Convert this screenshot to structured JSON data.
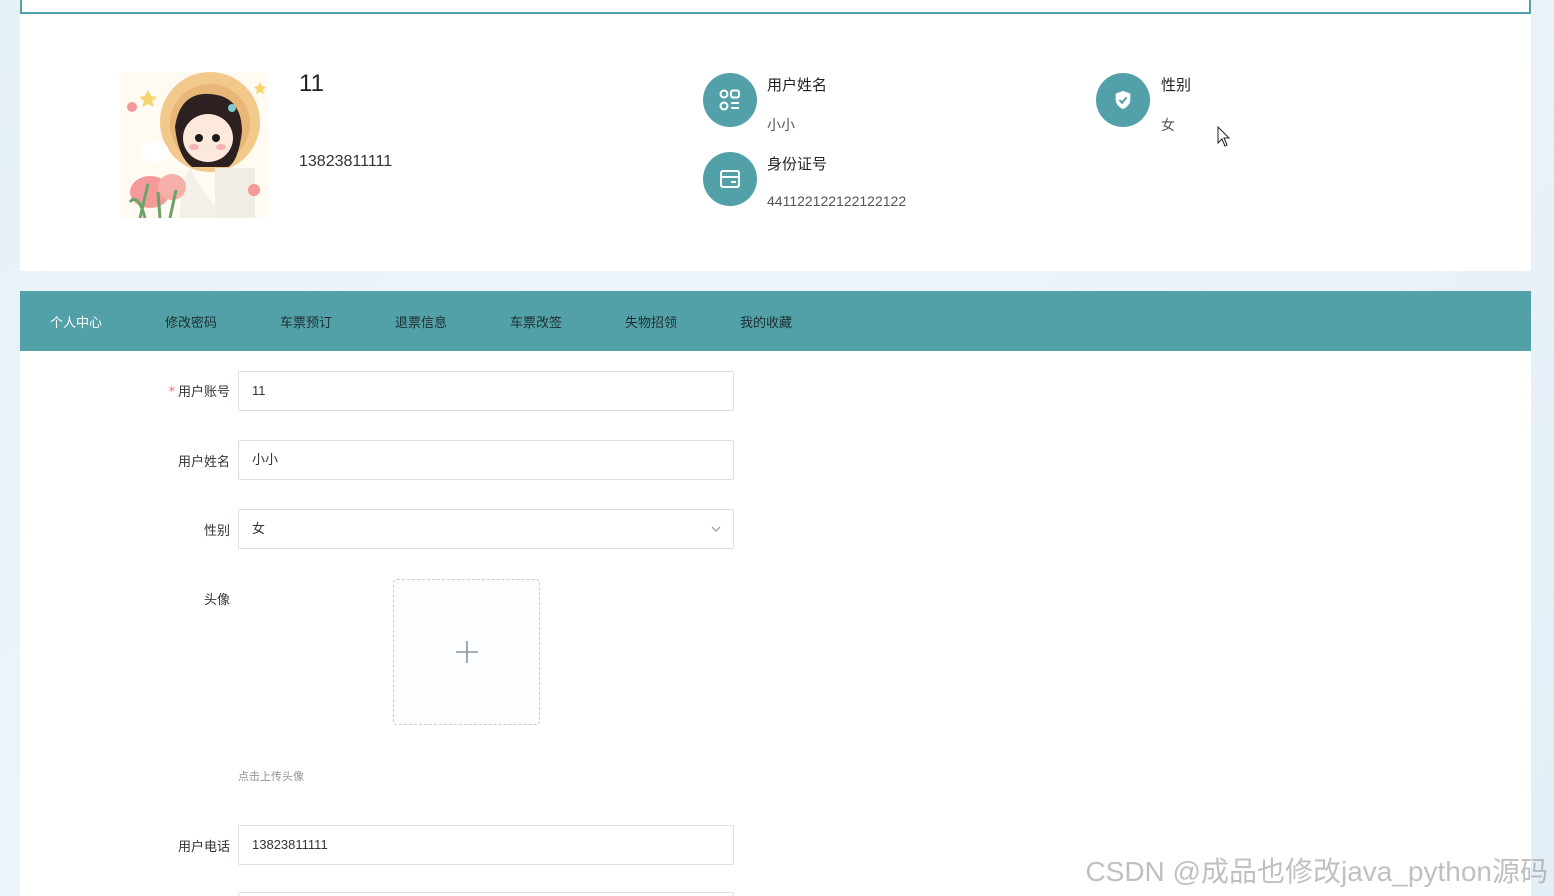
{
  "profile": {
    "account": "11",
    "phone": "13823811111",
    "name_label": "用户姓名",
    "name_value": "小小",
    "id_label": "身份证号",
    "id_value": "441122122122122122",
    "gender_label": "性别",
    "gender_value": "女",
    "icons": [
      "grid-icon",
      "card-icon",
      "shield-icon"
    ],
    "accent": "#52a1a8"
  },
  "tabs": [
    {
      "label": "个人中心",
      "active": true
    },
    {
      "label": "修改密码",
      "active": false
    },
    {
      "label": "车票预订",
      "active": false
    },
    {
      "label": "退票信息",
      "active": false
    },
    {
      "label": "车票改签",
      "active": false
    },
    {
      "label": "失物招领",
      "active": false
    },
    {
      "label": "我的收藏",
      "active": false
    }
  ],
  "form": {
    "account_label": "用户账号",
    "required_mark": "*",
    "account_value": "11",
    "name_label": "用户姓名",
    "name_value": "小小",
    "gender_label": "性别",
    "gender_value": "女",
    "avatar_label": "头像",
    "upload_tip": "点击上传头像",
    "phone_label": "用户电话",
    "phone_value": "13823811111"
  },
  "watermark": "CSDN @成品也修改java_python源码"
}
